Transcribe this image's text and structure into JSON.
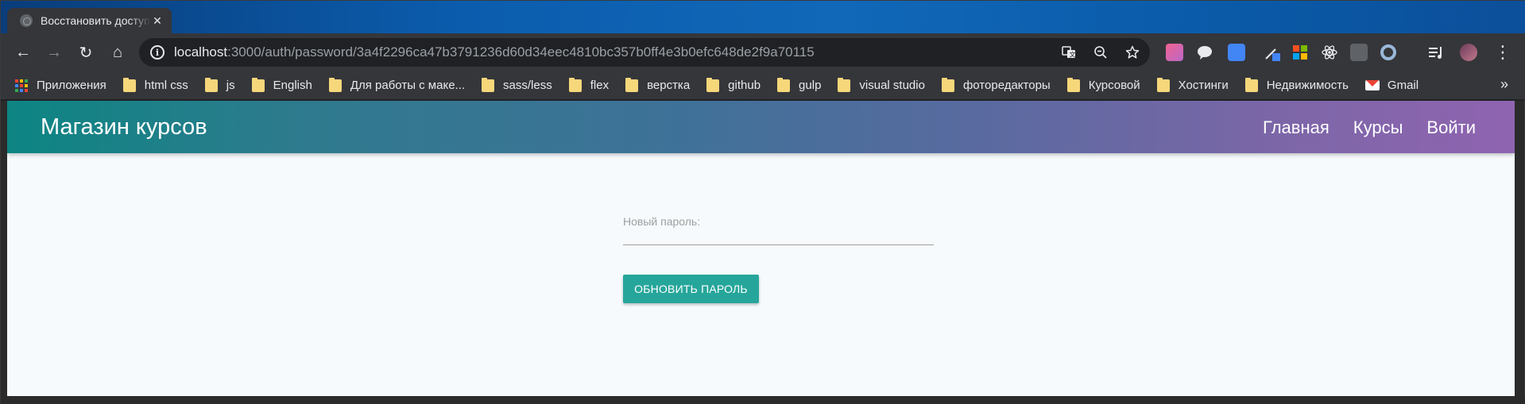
{
  "browser": {
    "tab": {
      "title": "Восстановить доступ",
      "close": "✕"
    },
    "nav": {
      "back": "←",
      "forward": "→",
      "reload": "↻",
      "home": "⌂"
    },
    "url": {
      "host": "localhost",
      "rest": ":3000/auth/password/3a4f2296ca47b3791236d60d34eec4810bc357b0ff4e3b0efc648de2f9a70115"
    },
    "omnibox_icons": [
      "translate-icon",
      "zoom-out-icon",
      "star-icon"
    ],
    "bookmarks": [
      {
        "label": "Приложения",
        "icon": "apps-icon"
      },
      {
        "label": "html css",
        "icon": "folder-icon"
      },
      {
        "label": "js",
        "icon": "folder-icon"
      },
      {
        "label": "English",
        "icon": "folder-icon"
      },
      {
        "label": "Для работы с маке...",
        "icon": "folder-icon"
      },
      {
        "label": "sass/less",
        "icon": "folder-icon"
      },
      {
        "label": "flex",
        "icon": "folder-icon"
      },
      {
        "label": "верстка",
        "icon": "folder-icon"
      },
      {
        "label": "github",
        "icon": "folder-icon"
      },
      {
        "label": "gulp",
        "icon": "folder-icon"
      },
      {
        "label": "visual studio",
        "icon": "folder-icon"
      },
      {
        "label": "фоторедакторы",
        "icon": "folder-icon"
      },
      {
        "label": "Курсовой",
        "icon": "folder-icon"
      },
      {
        "label": "Хостинги",
        "icon": "folder-icon"
      },
      {
        "label": "Недвижимость",
        "icon": "folder-icon"
      },
      {
        "label": "Gmail",
        "icon": "gmail-icon"
      }
    ],
    "more_bookmarks": "»"
  },
  "site": {
    "brand": "Магазин курсов",
    "nav": [
      "Главная",
      "Курсы",
      "Войти"
    ],
    "form": {
      "password_label": "Новый пароль:",
      "password_value": "",
      "submit_label": "ОБНОВИТЬ ПАРОЛЬ"
    }
  },
  "colors": {
    "accent_button": "#26a69a",
    "navbar_start": "#0d8583",
    "navbar_end": "#8f64b0"
  }
}
